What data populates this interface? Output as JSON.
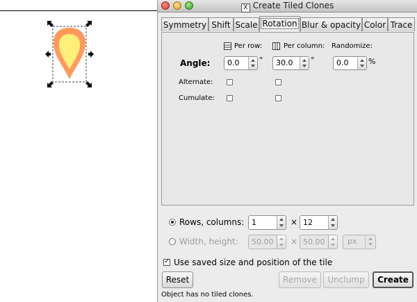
{
  "dialog": {
    "title": "Create Tiled Clones",
    "tabs": [
      {
        "label": "Symmetry",
        "active": false
      },
      {
        "label": "Shift",
        "active": false
      },
      {
        "label": "Scale",
        "active": false
      },
      {
        "label": "Rotation",
        "active": true
      },
      {
        "label": "Blur & opacity",
        "active": false
      },
      {
        "label": "Color",
        "active": false
      },
      {
        "label": "Trace",
        "active": false
      }
    ],
    "rotation": {
      "per_row_label": "Per row:",
      "per_column_label": "Per column:",
      "randomize_label": "Randomize:",
      "angle_label": "Angle:",
      "angle_per_row": "0.0",
      "angle_per_column": "30.0",
      "angle_randomize": "0.0",
      "degree_symbol": "°",
      "percent_symbol": "%",
      "alternate_label": "Alternate:",
      "cumulate_label": "Cumulate:"
    },
    "grid": {
      "rows_columns_label": "Rows, columns:",
      "rows": "1",
      "times_symbol": "×",
      "columns": "12",
      "width_height_label": "Width, height:",
      "width": "50.00",
      "height": "50.00",
      "unit": "px",
      "mode": "rows_columns"
    },
    "use_saved_label": "Use saved size and position of the tile",
    "use_saved_checked": true,
    "buttons": {
      "reset": "Reset",
      "remove": "Remove",
      "unclump": "Unclump",
      "create": "Create"
    },
    "status": "Object has no tiled clones."
  },
  "colors": {
    "shape_outer": "#ff9a5c",
    "shape_inner": "#fff07a"
  }
}
